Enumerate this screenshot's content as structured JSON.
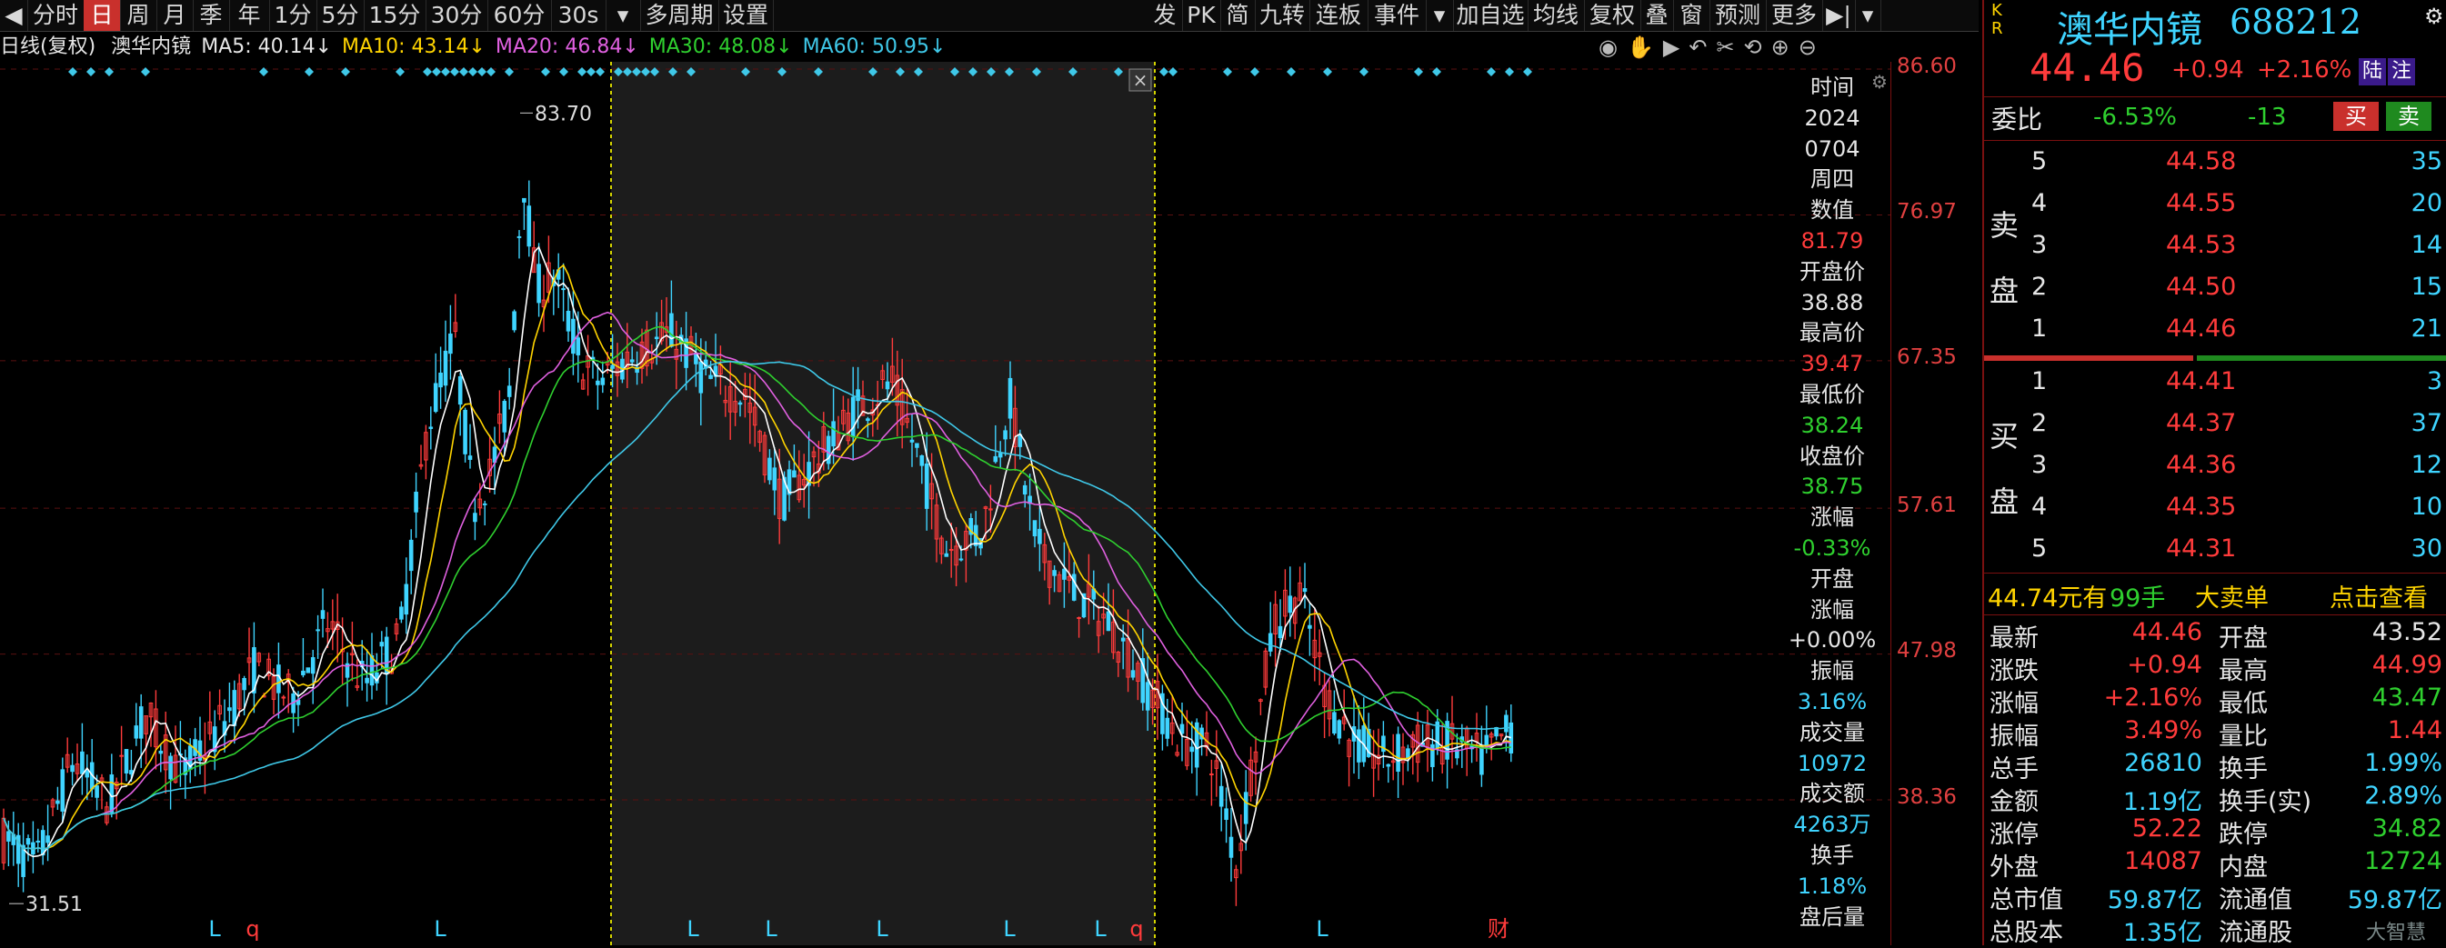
{
  "toolbar": {
    "items": [
      "分时",
      "日",
      "周",
      "月",
      "季",
      "年",
      "1分",
      "5分",
      "15分",
      "30分",
      "60分",
      "30s",
      "多周期",
      "设置",
      "发",
      "PK",
      "简",
      "九转",
      "连板",
      "事件",
      "加自选",
      "均线",
      "复权",
      "叠",
      "窗",
      "预测",
      "更多"
    ]
  },
  "info": {
    "period": "日线(复权)",
    "name": "澳华内镜",
    "ma5": "MA5: 40.14↓",
    "ma10": "MA10: 43.14↓",
    "ma20": "MA20: 46.84↓",
    "ma30": "MA30: 48.08↓",
    "ma60": "MA60: 50.95↓"
  },
  "axis": {
    "y_ticks": [
      "86.60",
      "76.97",
      "67.35",
      "57.61",
      "47.98",
      "38.36"
    ],
    "high_marker": "83.70",
    "low_marker": "31.51",
    "bottom_markers": [
      "L",
      "q",
      "L",
      "L",
      "L",
      "L",
      "L",
      "L",
      "q",
      "L",
      "财"
    ]
  },
  "data_panel": {
    "items": [
      "时间",
      "2024",
      "0704",
      "周四",
      "数值",
      "81.79",
      "开盘价",
      "38.88",
      "最高价",
      "39.47",
      "最低价",
      "38.24",
      "收盘价",
      "38.75",
      "涨幅",
      "-0.33%",
      "开盘",
      "涨幅",
      "+0.00%",
      "振幅",
      "3.16%",
      "成交量",
      "10972",
      "成交额",
      "4263万",
      "换手",
      "1.18%",
      "盘后量"
    ]
  },
  "quote": {
    "stock_name": "澳华内镜",
    "code": "688212",
    "tags": "K R",
    "price": "44.46",
    "change": "+0.94",
    "change_pct": "+2.16%",
    "badge1": "陆",
    "badge2": "注",
    "weibi_label": "委比",
    "weibi": "-6.53%",
    "weicha": "-13",
    "buy_btn": "买",
    "sell_btn": "卖",
    "sell_label": "卖盘",
    "buy_label": "买盘",
    "asks": [
      {
        "lvl": "5",
        "price": "44.58",
        "vol": "35"
      },
      {
        "lvl": "4",
        "price": "44.55",
        "vol": "20"
      },
      {
        "lvl": "3",
        "price": "44.53",
        "vol": "14"
      },
      {
        "lvl": "2",
        "price": "44.50",
        "vol": "15"
      },
      {
        "lvl": "1",
        "price": "44.46",
        "vol": "21"
      }
    ],
    "bids": [
      {
        "lvl": "1",
        "price": "44.41",
        "vol": "3"
      },
      {
        "lvl": "2",
        "price": "44.37",
        "vol": "37"
      },
      {
        "lvl": "3",
        "price": "44.36",
        "vol": "12"
      },
      {
        "lvl": "4",
        "price": "44.35",
        "vol": "10"
      },
      {
        "lvl": "5",
        "price": "44.31",
        "vol": "30"
      }
    ],
    "bigorder": {
      "price": "44.74元有",
      "hands": "99手",
      "label": "大卖单",
      "link": "点击查看"
    },
    "stats": [
      {
        "l1": "最新",
        "v1": "44.46",
        "c1": "r",
        "l2": "开盘",
        "v2": "43.52",
        "c2": "w"
      },
      {
        "l1": "涨跌",
        "v1": "+0.94",
        "c1": "r",
        "l2": "最高",
        "v2": "44.99",
        "c2": "r"
      },
      {
        "l1": "涨幅",
        "v1": "+2.16%",
        "c1": "r",
        "l2": "最低",
        "v2": "43.47",
        "c2": "g"
      },
      {
        "l1": "振幅",
        "v1": "3.49%",
        "c1": "r",
        "l2": "量比",
        "v2": "1.44",
        "c2": "r"
      },
      {
        "l1": "总手",
        "v1": "26810",
        "c1": "c",
        "l2": "换手",
        "v2": "1.99%",
        "c2": "c"
      },
      {
        "l1": "金额",
        "v1": "1.19亿",
        "c1": "c",
        "l2": "换手(实)",
        "v2": "2.89%",
        "c2": "c"
      },
      {
        "l1": "涨停",
        "v1": "52.22",
        "c1": "r",
        "l2": "跌停",
        "v2": "34.82",
        "c2": "g"
      },
      {
        "l1": "外盘",
        "v1": "14087",
        "c1": "r",
        "l2": "内盘",
        "v2": "12724",
        "c2": "g"
      },
      {
        "l1": "总市值",
        "v1": "59.87亿",
        "c1": "c",
        "l2": "流通值",
        "v2": "59.87亿",
        "c2": "c"
      },
      {
        "l1": "总股本",
        "v1": "1.35亿",
        "c1": "c",
        "l2": "流通股",
        "v2": "",
        "c2": "c"
      }
    ],
    "watermark": "大智慧"
  },
  "colors": {
    "up": "#ff3b3b",
    "down": "#2fd02f",
    "ma5": "#ffffff",
    "ma10": "#ffd400",
    "ma20": "#e060e0",
    "ma30": "#2fd02f",
    "ma60": "#3fc8e8",
    "accent": "#3fd4ff"
  }
}
